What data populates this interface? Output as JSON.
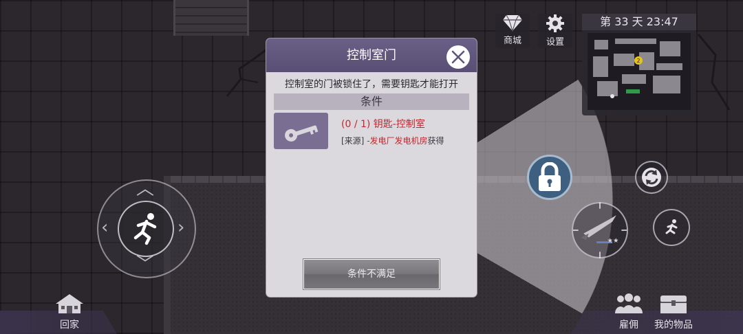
{
  "hud": {
    "shop_label": "商城",
    "settings_label": "设置",
    "day_text": "第 33 天  23:47",
    "shop_icon": "diamond-icon",
    "settings_icon": "gear-icon"
  },
  "dialog": {
    "title": "控制室门",
    "description": "控制室的门被锁住了，需要钥匙才能打开",
    "conditions_header": "条件",
    "item": {
      "name": "(0 / 1) 钥匙-控制室",
      "source_prefix": "[来源]",
      "source_value": " -发电厂发电机房",
      "source_suffix": "获得",
      "icon": "key-icon"
    },
    "button_label": "条件不满足"
  },
  "bottom": {
    "home_label": "回家",
    "hire_label": "雇佣",
    "items_label": "我的物品"
  },
  "minimap": {
    "marker_number": "2"
  },
  "colors": {
    "dialog_header": "#5f5579",
    "requirement_red": "#c4242c",
    "lock_button": "#3e5f80"
  }
}
